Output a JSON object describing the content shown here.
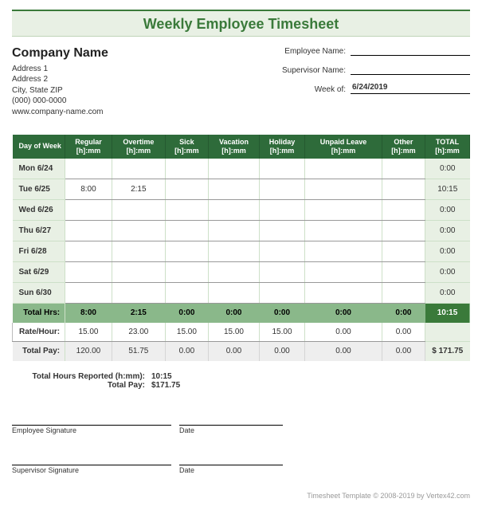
{
  "title": "Weekly Employee Timesheet",
  "company": {
    "name": "Company Name",
    "address1": "Address 1",
    "address2": "Address 2",
    "citystatezip": "City, State  ZIP",
    "phone": "(000) 000-0000",
    "website": "www.company-name.com"
  },
  "fields": {
    "employee_label": "Employee Name:",
    "employee_value": "",
    "supervisor_label": "Supervisor Name:",
    "supervisor_value": "",
    "weekof_label": "Week of:",
    "weekof_value": "6/24/2019"
  },
  "columns": {
    "day": "Day of Week",
    "regular": "Regular",
    "overtime": "Overtime",
    "sick": "Sick",
    "vacation": "Vacation",
    "holiday": "Holiday",
    "unpaid": "Unpaid Leave",
    "other": "Other",
    "total": "TOTAL",
    "unit": "[h]:mm"
  },
  "rows": [
    {
      "day": "Mon 6/24",
      "regular": "",
      "overtime": "",
      "sick": "",
      "vacation": "",
      "holiday": "",
      "unpaid": "",
      "other": "",
      "total": "0:00"
    },
    {
      "day": "Tue 6/25",
      "regular": "8:00",
      "overtime": "2:15",
      "sick": "",
      "vacation": "",
      "holiday": "",
      "unpaid": "",
      "other": "",
      "total": "10:15"
    },
    {
      "day": "Wed 6/26",
      "regular": "",
      "overtime": "",
      "sick": "",
      "vacation": "",
      "holiday": "",
      "unpaid": "",
      "other": "",
      "total": "0:00"
    },
    {
      "day": "Thu 6/27",
      "regular": "",
      "overtime": "",
      "sick": "",
      "vacation": "",
      "holiday": "",
      "unpaid": "",
      "other": "",
      "total": "0:00"
    },
    {
      "day": "Fri 6/28",
      "regular": "",
      "overtime": "",
      "sick": "",
      "vacation": "",
      "holiday": "",
      "unpaid": "",
      "other": "",
      "total": "0:00"
    },
    {
      "day": "Sat 6/29",
      "regular": "",
      "overtime": "",
      "sick": "",
      "vacation": "",
      "holiday": "",
      "unpaid": "",
      "other": "",
      "total": "0:00"
    },
    {
      "day": "Sun 6/30",
      "regular": "",
      "overtime": "",
      "sick": "",
      "vacation": "",
      "holiday": "",
      "unpaid": "",
      "other": "",
      "total": "0:00"
    }
  ],
  "totals": {
    "label": "Total Hrs:",
    "regular": "8:00",
    "overtime": "2:15",
    "sick": "0:00",
    "vacation": "0:00",
    "holiday": "0:00",
    "unpaid": "0:00",
    "other": "0:00",
    "total": "10:15"
  },
  "rate": {
    "label": "Rate/Hour:",
    "regular": "15.00",
    "overtime": "23.00",
    "sick": "15.00",
    "vacation": "15.00",
    "holiday": "15.00",
    "unpaid": "0.00",
    "other": "0.00",
    "total": ""
  },
  "pay": {
    "label": "Total Pay:",
    "regular": "120.00",
    "overtime": "51.75",
    "sick": "0.00",
    "vacation": "0.00",
    "holiday": "0.00",
    "unpaid": "0.00",
    "other": "0.00",
    "total": "$   171.75"
  },
  "summary": {
    "hours_label": "Total Hours Reported (h:mm):",
    "hours_value": "10:15",
    "pay_label": "Total Pay:",
    "pay_value": "$171.75"
  },
  "signatures": {
    "employee": "Employee Signature",
    "supervisor": "Supervisor Signature",
    "date": "Date"
  },
  "footer": "Timesheet Template © 2008-2019 by Vertex42.com"
}
